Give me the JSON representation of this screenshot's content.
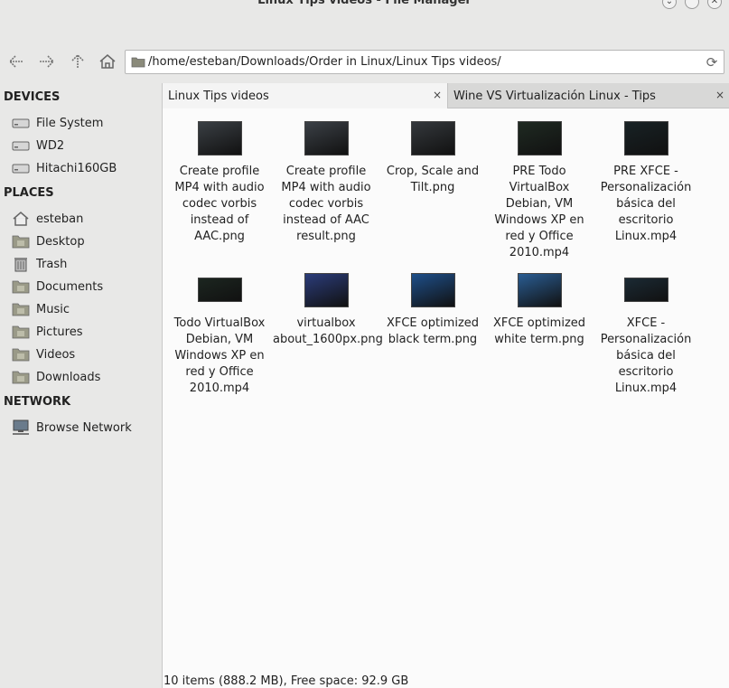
{
  "window": {
    "title": "Linux Tips videos - File Manager"
  },
  "toolbar": {
    "path": "/home/esteban/Downloads/Order in Linux/Linux Tips videos/"
  },
  "sidebar": {
    "devices_header": "DEVICES",
    "devices": [
      {
        "label": "File System",
        "icon": "drive-icon"
      },
      {
        "label": "WD2",
        "icon": "drive-icon"
      },
      {
        "label": "Hitachi160GB",
        "icon": "drive-icon"
      }
    ],
    "places_header": "PLACES",
    "places": [
      {
        "label": "esteban",
        "icon": "home-icon"
      },
      {
        "label": "Desktop",
        "icon": "folder-icon"
      },
      {
        "label": "Trash",
        "icon": "trash-icon"
      },
      {
        "label": "Documents",
        "icon": "folder-icon"
      },
      {
        "label": "Music",
        "icon": "folder-icon"
      },
      {
        "label": "Pictures",
        "icon": "folder-icon"
      },
      {
        "label": "Videos",
        "icon": "folder-icon"
      },
      {
        "label": "Downloads",
        "icon": "folder-icon"
      }
    ],
    "network_header": "NETWORK",
    "network": [
      {
        "label": "Browse Network",
        "icon": "network-icon"
      }
    ]
  },
  "tabs": [
    {
      "label": "Linux Tips videos",
      "close": "×"
    },
    {
      "label": "Wine VS Virtualización Linux - Tips",
      "close": "×"
    }
  ],
  "files": [
    {
      "name": "Create profile MP4 with audio codec vorbis instead of AAC.png",
      "thumb_color": "#3a3f44"
    },
    {
      "name": "Create profile MP4 with audio codec vorbis instead of AAC result.png",
      "thumb_color": "#3b4046"
    },
    {
      "name": "Crop, Scale and Tilt.png",
      "thumb_color": "#34383c"
    },
    {
      "name": "PRE Todo VirtualBox Debian, VM Windows XP en red y Office 2010.mp4",
      "thumb_color": "#1f2a22"
    },
    {
      "name": "PRE XFCE - Personalización básica del escritorio Linux.mp4",
      "thumb_color": "#182225"
    },
    {
      "name": "Todo VirtualBox Debian, VM Windows XP en red y Office 2010.mp4",
      "thumb_color": "#1c2620"
    },
    {
      "name": "virtualbox about_1600px.png",
      "thumb_color": "#2b3c7a"
    },
    {
      "name": "XFCE optimized black term.png",
      "thumb_color": "#1e4f8a"
    },
    {
      "name": "XFCE optimized white term.png",
      "thumb_color": "#2a5d93"
    },
    {
      "name": "XFCE - Personalización básica del escritorio Linux.mp4",
      "thumb_color": "#1b2a34"
    }
  ],
  "status": {
    "text": "10 items (888.2 MB), Free space: 92.9 GB"
  }
}
